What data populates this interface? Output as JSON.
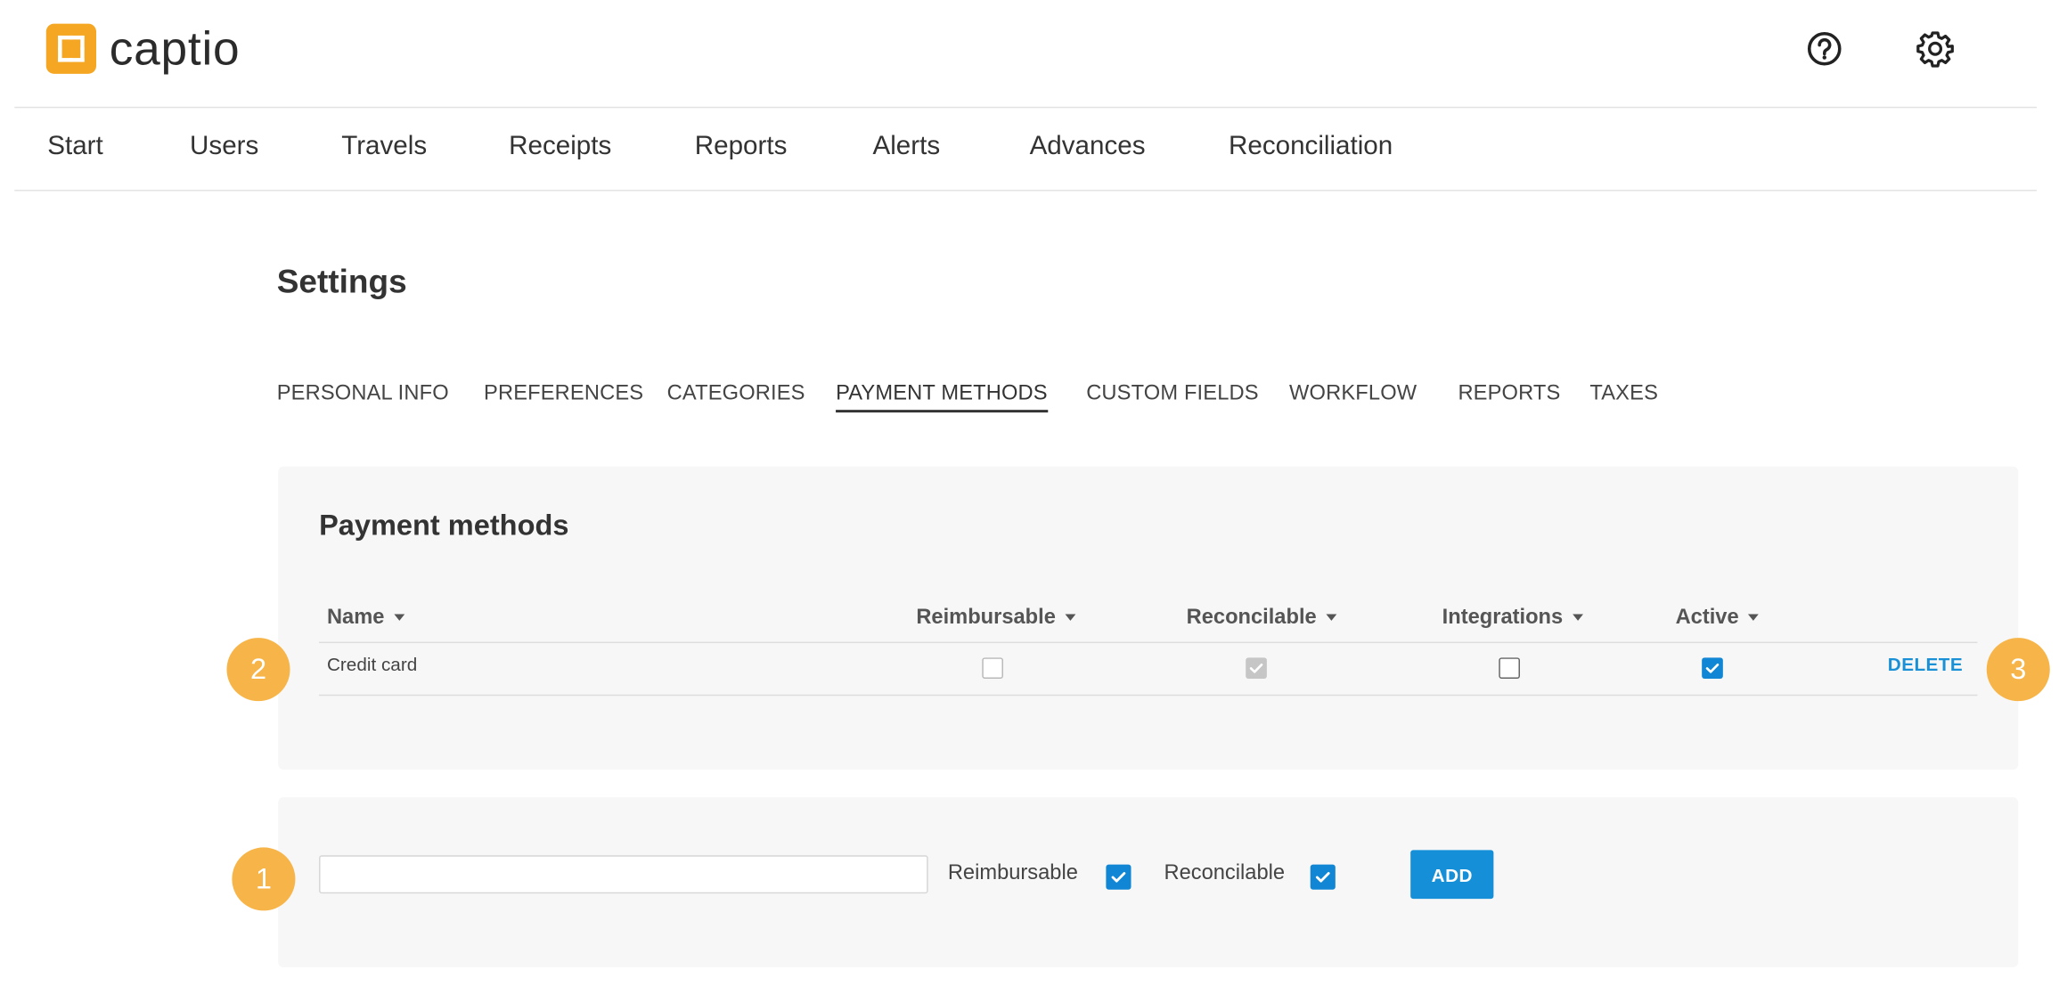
{
  "app": {
    "logo_text": "captio",
    "brand_color": "#f5a623",
    "accent_color": "#1590d8"
  },
  "header": {
    "icons": [
      "help-icon",
      "gear-icon"
    ]
  },
  "nav": {
    "items": [
      "Start",
      "Users",
      "Travels",
      "Receipts",
      "Reports",
      "Alerts",
      "Advances",
      "Reconciliation"
    ]
  },
  "page": {
    "title": "Settings"
  },
  "tabs": {
    "items": [
      "PERSONAL INFO",
      "PREFERENCES",
      "CATEGORIES",
      "PAYMENT METHODS",
      "CUSTOM FIELDS",
      "WORKFLOW",
      "REPORTS",
      "TAXES"
    ],
    "active": "PAYMENT METHODS"
  },
  "payment_methods": {
    "title": "Payment methods",
    "columns": [
      "Name",
      "Reimbursable",
      "Reconcilable",
      "Integrations",
      "Active"
    ],
    "rows": [
      {
        "name": "Credit card",
        "reimbursable": false,
        "reconcilable": true,
        "integrations": false,
        "active": true,
        "action": "DELETE"
      }
    ]
  },
  "add_form": {
    "input_value": "",
    "input_placeholder": "",
    "reimbursable_label": "Reimbursable",
    "reimbursable_checked": true,
    "reconcilable_label": "Reconcilable",
    "reconcilable_checked": true,
    "add_label": "ADD"
  },
  "annotations": {
    "badge_1": "1",
    "badge_2": "2",
    "badge_3": "3"
  }
}
